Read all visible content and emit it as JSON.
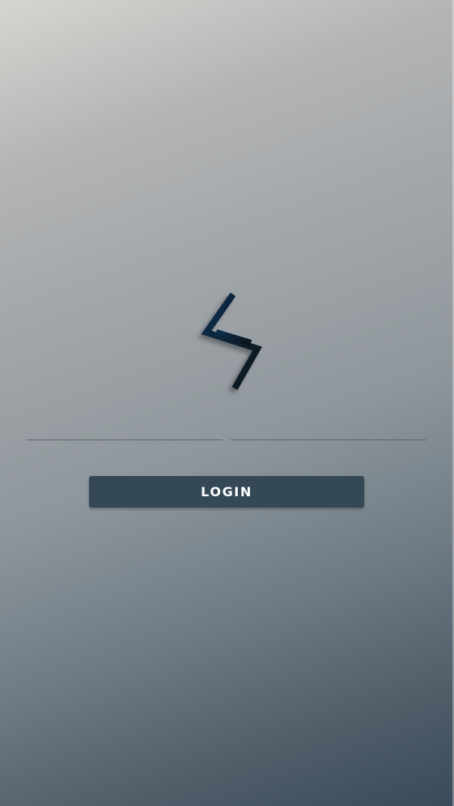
{
  "app": {
    "logo_icon": "stylized-lightning-logo-icon"
  },
  "login_form": {
    "username": {
      "value": "",
      "placeholder": ""
    },
    "password": {
      "value": "",
      "placeholder": ""
    },
    "login_label": "LOGIN"
  },
  "colors": {
    "button_background": "#344856",
    "button_text": "#ffffff",
    "logo_stroke": "#0e2133",
    "background_top": "#d7d5d0",
    "background_bottom": "#3a4a58"
  }
}
